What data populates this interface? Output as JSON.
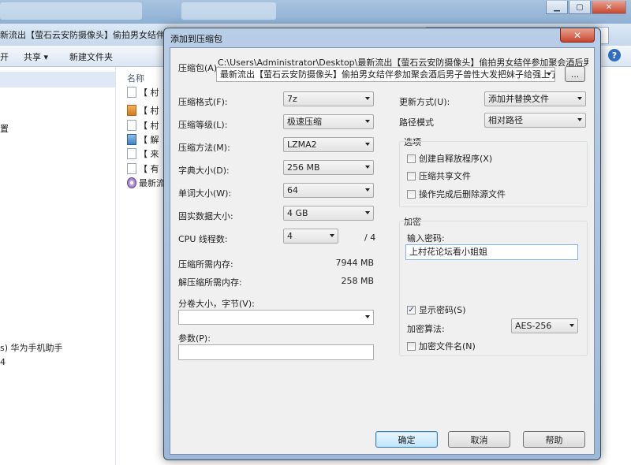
{
  "explorer": {
    "address_text": "新流出【萤石云安防摄像头】偷拍男女结伴",
    "toolbar": {
      "organize_partial": "开",
      "share": "共享 ▾",
      "new_folder": "新建文件夹"
    },
    "nav_items": [
      "置",
      "s) 华为手机助手",
      "4"
    ],
    "list_header": "名称",
    "files": [
      "【 村",
      "【 村",
      "【 村",
      "【 解",
      "【 来",
      "【 有",
      "最新流"
    ]
  },
  "dialog": {
    "title": "添加到压缩包",
    "close_glyph": "✕",
    "archive_label": "压缩包(A):",
    "archive_dir": "C:\\Users\\Administrator\\Desktop\\最新流出【萤石云安防摄像头】偷拍男女结伴参加聚会酒后男子兽性大",
    "archive_name": "最新流出【萤石云安防摄像头】偷拍男女结伴参加聚会酒后男子兽性大发把妹子给强上了",
    "browse_label": "...",
    "format_label": "压缩格式(F):",
    "format_value": "7z",
    "level_label": "压缩等级(L):",
    "level_value": "极速压缩",
    "method_label": "压缩方法(M):",
    "method_value": "LZMA2",
    "dict_label": "字典大小(D):",
    "dict_value": "256 MB",
    "word_label": "单词大小(W):",
    "word_value": "64",
    "solid_label": "固实数据大小:",
    "solid_value": "4 GB",
    "threads_label": "CPU 线程数:",
    "threads_value": "4",
    "threads_total": "/ 4",
    "mem_compress_label": "压缩所需内存:",
    "mem_compress_value": "7944 MB",
    "mem_decompress_label": "解压缩所需内存:",
    "mem_decompress_value": "258 MB",
    "split_label": "分卷大小，字节(V):",
    "split_value": "",
    "params_label": "参数(P):",
    "params_value": "",
    "update_label": "更新方式(U):",
    "update_value": "添加并替换文件",
    "pathmode_label": "路径模式",
    "pathmode_value": "相对路径",
    "options_title": "选项",
    "opt_sfx": "创建自释放程序(X)",
    "opt_shared": "压缩共享文件",
    "opt_delete": "操作完成后删除源文件",
    "encrypt_title": "加密",
    "password_label": "输入密码:",
    "password_value": "上村花论坛看小姐姐",
    "show_password": "显示密码(S)",
    "show_password_checked": true,
    "enc_method_label": "加密算法:",
    "enc_method_value": "AES-256",
    "encrypt_names": "加密文件名(N)",
    "ok_label": "确定",
    "cancel_label": "取消",
    "help_label": "帮助"
  }
}
